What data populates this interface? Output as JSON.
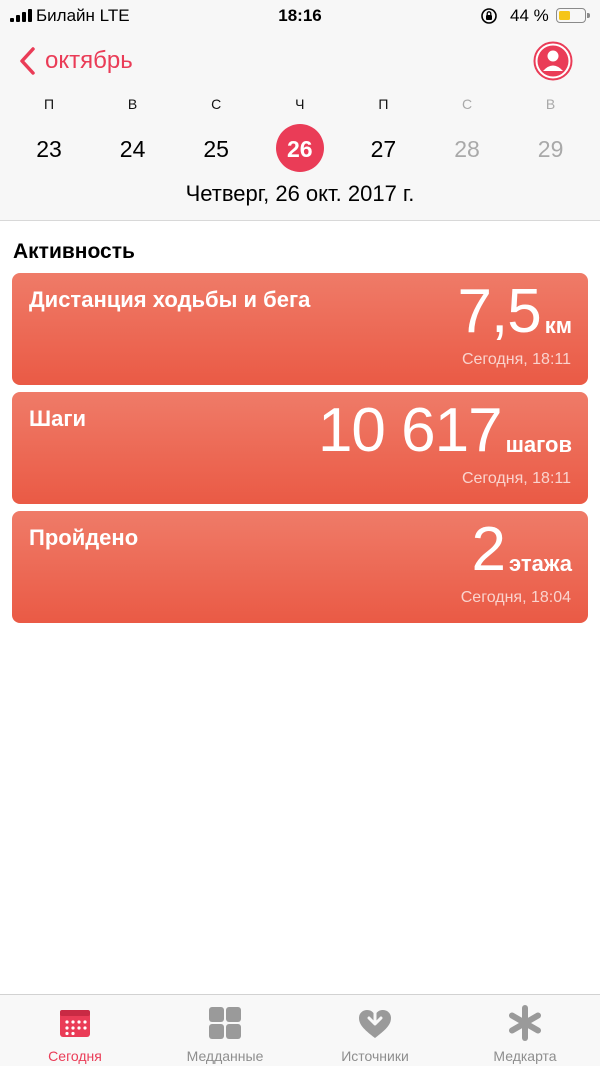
{
  "status_bar": {
    "carrier": "Билайн  LTE",
    "time": "18:16",
    "battery": "44 %",
    "battery_level": 0.44
  },
  "nav": {
    "back_label": "октябрь"
  },
  "week": {
    "days": [
      {
        "letter": "П",
        "num": "23"
      },
      {
        "letter": "В",
        "num": "24"
      },
      {
        "letter": "С",
        "num": "25"
      },
      {
        "letter": "Ч",
        "num": "26"
      },
      {
        "letter": "П",
        "num": "27"
      },
      {
        "letter": "С",
        "num": "28"
      },
      {
        "letter": "В",
        "num": "29"
      }
    ],
    "selected_index": 3,
    "full_date": "Четверг, 26 окт. 2017 г."
  },
  "activity": {
    "title": "Активность",
    "cards": [
      {
        "title": "Дистанция ходьбы и бега",
        "value": "7,5",
        "unit": "км",
        "time": "Сегодня, 18:11"
      },
      {
        "title": "Шаги",
        "value": "10 617",
        "unit": "шагов",
        "time": "Сегодня, 18:11"
      },
      {
        "title": "Пройдено",
        "value": "2",
        "unit": "этажа",
        "time": "Сегодня, 18:04"
      }
    ]
  },
  "tabs": [
    {
      "label": "Сегодня",
      "icon": "calendar-icon"
    },
    {
      "label": "Медданные",
      "icon": "grid-icon"
    },
    {
      "label": "Источники",
      "icon": "heart-download-icon"
    },
    {
      "label": "Медкарта",
      "icon": "asterisk-icon"
    }
  ],
  "colors": {
    "accent": "#ea3c57",
    "card_top": "#ef7b68",
    "card_bottom": "#ea5a45"
  }
}
